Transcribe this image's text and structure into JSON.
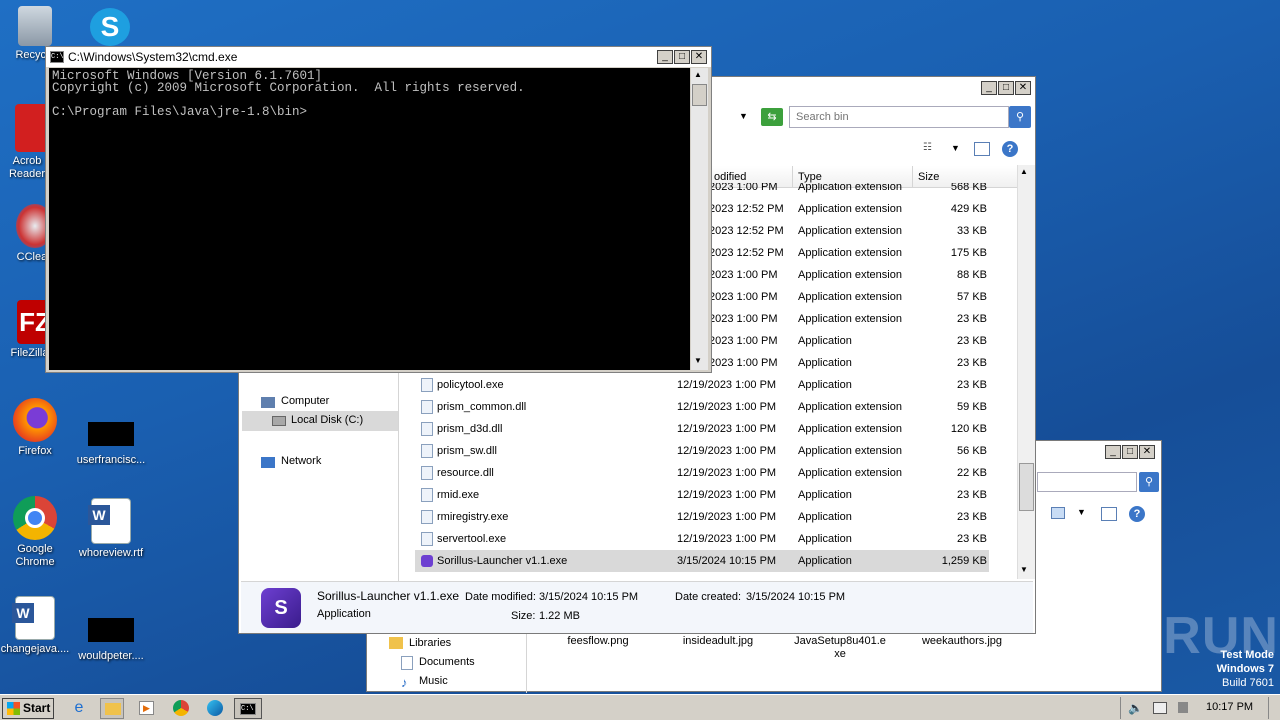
{
  "desktop": {
    "icons": [
      {
        "label": "Recycle",
        "icon": "recycle-bin-icon"
      },
      {
        "label": "Acrob Reader",
        "icon": "acrobat-icon"
      },
      {
        "label": "CClean",
        "icon": "ccleaner-icon"
      },
      {
        "label": "FileZilla C",
        "icon": "filezilla-icon"
      },
      {
        "label": "Firefox",
        "icon": "firefox-icon"
      },
      {
        "label": "userfrancisc...",
        "icon": "blank-icon"
      },
      {
        "label": "Google Chrome",
        "icon": "chrome-icon"
      },
      {
        "label": "whoreview.rtf",
        "icon": "word-doc-icon"
      },
      {
        "label": "changejava....",
        "icon": "word-doc-icon"
      },
      {
        "label": "wouldpeter....",
        "icon": "blank-icon"
      }
    ],
    "watermark": "ANY RUN",
    "test_mode": [
      "Test Mode",
      "Windows 7",
      "Build 7601"
    ]
  },
  "cmd": {
    "title": "C:\\Windows\\System32\\cmd.exe",
    "lines": [
      "Microsoft Windows [Version 6.1.7601]",
      "Copyright (c) 2009 Microsoft Corporation.  All rights reserved.",
      "",
      "C:\\Program Files\\Java\\jre-1.8\\bin>"
    ]
  },
  "explorer": {
    "search_placeholder": "Search bin",
    "columns": {
      "modified": "odified",
      "type": "Type",
      "size": "Size"
    },
    "nav": {
      "computer": "Computer",
      "local_disk": "Local Disk (C:)",
      "network": "Network"
    },
    "top_rows": [
      {
        "date": "2023 1:00 PM",
        "type": "Application extension",
        "size": "568 KB"
      },
      {
        "date": "2023 12:52 PM",
        "type": "Application extension",
        "size": "429 KB"
      },
      {
        "date": "2023 12:52 PM",
        "type": "Application extension",
        "size": "33 KB"
      },
      {
        "date": "2023 12:52 PM",
        "type": "Application extension",
        "size": "175 KB"
      },
      {
        "date": "2023 1:00 PM",
        "type": "Application extension",
        "size": "88 KB"
      },
      {
        "date": "2023 1:00 PM",
        "type": "Application extension",
        "size": "57 KB"
      },
      {
        "date": "2023 1:00 PM",
        "type": "Application extension",
        "size": "23 KB"
      },
      {
        "date": "2023 1:00 PM",
        "type": "Application",
        "size": "23 KB"
      },
      {
        "date": "2023 1:00 PM",
        "type": "Application",
        "size": "23 KB"
      }
    ],
    "rows": [
      {
        "name": "policytool.exe",
        "date": "12/19/2023 1:00 PM",
        "type": "Application",
        "size": "23 KB"
      },
      {
        "name": "prism_common.dll",
        "date": "12/19/2023 1:00 PM",
        "type": "Application extension",
        "size": "59 KB"
      },
      {
        "name": "prism_d3d.dll",
        "date": "12/19/2023 1:00 PM",
        "type": "Application extension",
        "size": "120 KB"
      },
      {
        "name": "prism_sw.dll",
        "date": "12/19/2023 1:00 PM",
        "type": "Application extension",
        "size": "56 KB"
      },
      {
        "name": "resource.dll",
        "date": "12/19/2023 1:00 PM",
        "type": "Application extension",
        "size": "22 KB"
      },
      {
        "name": "rmid.exe",
        "date": "12/19/2023 1:00 PM",
        "type": "Application",
        "size": "23 KB"
      },
      {
        "name": "rmiregistry.exe",
        "date": "12/19/2023 1:00 PM",
        "type": "Application",
        "size": "23 KB"
      },
      {
        "name": "servertool.exe",
        "date": "12/19/2023 1:00 PM",
        "type": "Application",
        "size": "23 KB"
      },
      {
        "name": "Sorillus-Launcher v1.1.exe",
        "date": "3/15/2024 10:15 PM",
        "type": "Application",
        "size": "1,259 KB"
      }
    ],
    "details": {
      "name": "Sorillus-Launcher v1.1.exe",
      "type": "Application",
      "date_modified_label": "Date modified:",
      "date_modified": "3/15/2024 10:15 PM",
      "size_label": "Size:",
      "size": "1.22 MB",
      "date_created_label": "Date created:",
      "date_created": "3/15/2024 10:15 PM"
    }
  },
  "explorer2": {
    "nav": {
      "libraries": "Libraries",
      "documents": "Documents",
      "music": "Music"
    },
    "files": [
      "feesflow.png",
      "insideadult.jpg",
      "JavaSetup8u401.e\nxe",
      "weekauthors.jpg"
    ]
  },
  "taskbar": {
    "start": "Start",
    "clock": "10:17 PM"
  }
}
